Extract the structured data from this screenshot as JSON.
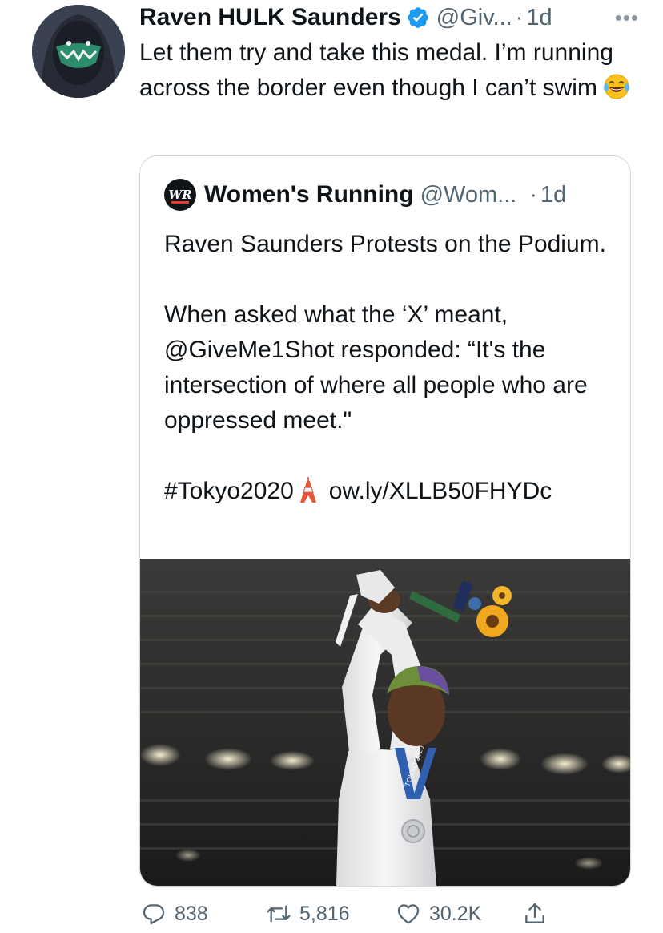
{
  "tweet": {
    "author_name": "Raven HULK Saunders",
    "handle": "@Giv...",
    "separator": "·",
    "time": "1d",
    "more_label": "•••",
    "text": "Let them try and take this medal. I’m running across the border even though I can’t swim",
    "avatar_icon": "masked-avatar",
    "verified_icon": "verified-badge-icon",
    "emoji_icon": "face-with-tears-of-joy-icon"
  },
  "quote": {
    "avatar_text": "WR",
    "author_name": "Women's Running",
    "handle": "@Wom...",
    "separator": "·",
    "time": "1d",
    "line1": "Raven Saunders Protests on the Podium.",
    "line2": "When asked what the ‘X’ meant, @GiveMe1Shot responded: “It's the intersection of where all people who are oppressed meet.\"",
    "hashtag": "#Tokyo2020",
    "link": "ow.ly/XLLB50FHYDc",
    "tower_icon": "tokyo-tower-icon",
    "medal_ribbon_text": "TOKYO 2020"
  },
  "actions": {
    "reply_count": "838",
    "retweet_count": "5,816",
    "like_count": "30.2K"
  },
  "colors": {
    "text": "#0f1419",
    "secondary": "#536471",
    "verified": "#1d9bf0",
    "border": "#cfd9de"
  }
}
